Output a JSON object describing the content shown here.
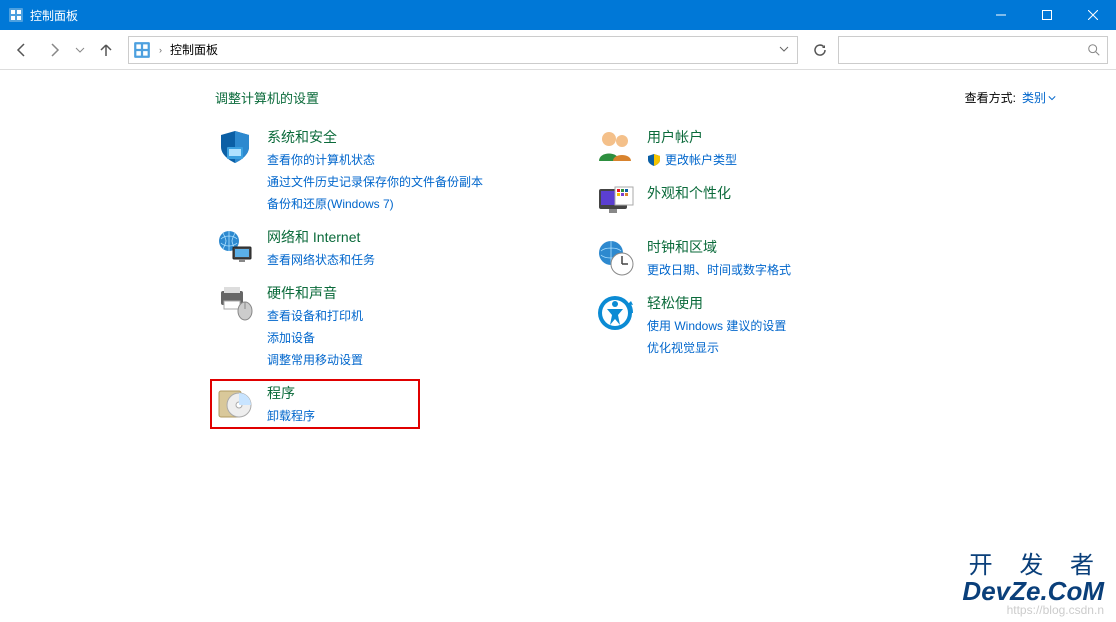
{
  "window": {
    "title": "控制面板"
  },
  "nav": {
    "address": "控制面板"
  },
  "header": {
    "title": "调整计算机的设置",
    "view_by_label": "查看方式:",
    "view_by_value": "类别"
  },
  "categories_left": [
    {
      "id": "system-security",
      "title": "系统和安全",
      "icon": "shield",
      "links": [
        "查看你的计算机状态",
        "通过文件历史记录保存你的文件备份副本",
        "备份和还原(Windows 7)"
      ]
    },
    {
      "id": "network-internet",
      "title": "网络和 Internet",
      "icon": "globe-monitor",
      "links": [
        "查看网络状态和任务"
      ]
    },
    {
      "id": "hardware-sound",
      "title": "硬件和声音",
      "icon": "printer",
      "links": [
        "查看设备和打印机",
        "添加设备",
        "调整常用移动设置"
      ]
    },
    {
      "id": "programs",
      "title": "程序",
      "icon": "disc-box",
      "highlighted": true,
      "links": [
        "卸载程序"
      ]
    }
  ],
  "categories_right": [
    {
      "id": "user-accounts",
      "title": "用户帐户",
      "icon": "users",
      "links_with_shield": [
        {
          "text": "更改帐户类型",
          "shield": true
        }
      ]
    },
    {
      "id": "appearance-personalization",
      "title": "外观和个性化",
      "icon": "monitor-grid",
      "links": []
    },
    {
      "id": "clock-region",
      "title": "时钟和区域",
      "icon": "clock-globe",
      "links": [
        "更改日期、时间或数字格式"
      ]
    },
    {
      "id": "ease-of-access",
      "title": "轻松使用",
      "icon": "ease",
      "links": [
        "使用 Windows 建议的设置",
        "优化视觉显示"
      ]
    }
  ],
  "watermarks": {
    "csdn": "https://blog.csdn.n",
    "kfz": "开 发 者",
    "devze": "DevZe.CoM"
  }
}
